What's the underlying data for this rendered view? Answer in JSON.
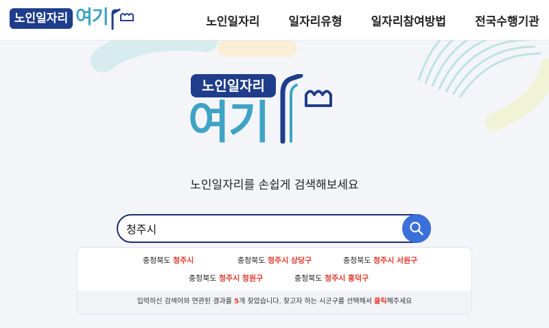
{
  "header": {
    "logo": {
      "badge": "노인일자리",
      "word": "여기"
    },
    "nav": [
      "노인일자리",
      "일자리유형",
      "일자리참여방법",
      "전국수행기관"
    ]
  },
  "hero": {
    "logo": {
      "badge": "노인일자리",
      "word": "여기"
    },
    "tagline": "노인일자리를 손쉽게 검색해보세요",
    "search": {
      "value": "청주시",
      "button_icon": "search-icon"
    }
  },
  "results": {
    "items": [
      {
        "province": "충청북도",
        "city": "청주시",
        "district": ""
      },
      {
        "province": "충청북도",
        "city": "청주시",
        "district": "상당구"
      },
      {
        "province": "충청북도",
        "city": "청주시",
        "district": "서원구"
      },
      {
        "province": "충청북도",
        "city": "청주시",
        "district": "청원구"
      },
      {
        "province": "충청북도",
        "city": "청주시",
        "district": "흥덕구"
      }
    ],
    "summary": {
      "part1": "입력하신 검색어와 연관된 결과를 ",
      "count": "5",
      "part2": "개 찾았습니다. 찾고자 하는 시군구를 선택해서 ",
      "click": "클릭",
      "part3": "해주세요"
    }
  },
  "colors": {
    "brand_navy": "#1f3d8a",
    "brand_teal": "#3ea3c4",
    "highlight_red": "#e23a2e",
    "search_button": "#3b6fd9"
  }
}
